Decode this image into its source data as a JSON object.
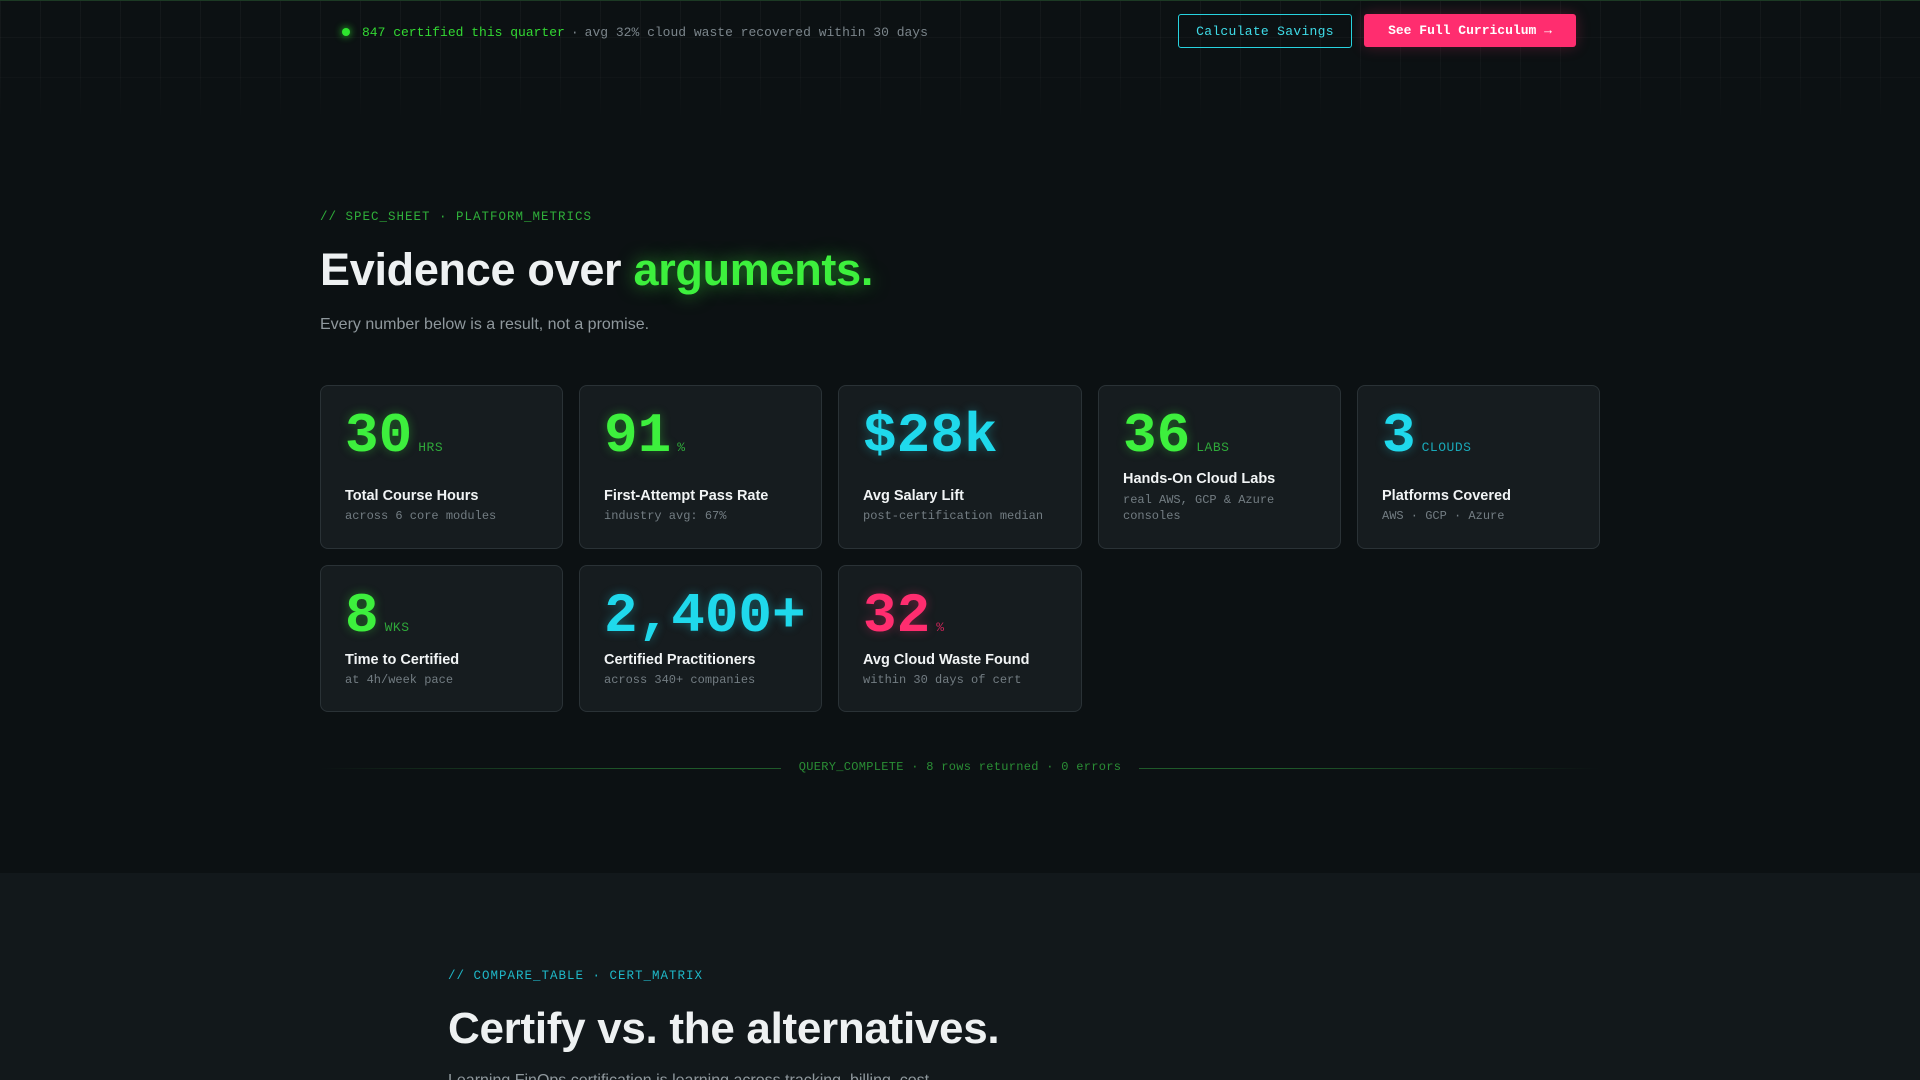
{
  "topbar": {
    "ticker_highlight": "847 certified this quarter",
    "ticker_separator": "·",
    "ticker_rest": "avg 32% cloud waste recovered within 30 days",
    "calculate_button": "Calculate Savings",
    "curriculum_button": "See Full Curriculum →"
  },
  "metrics": {
    "eyebrow": "// SPEC_SHEET · PLATFORM_METRICS",
    "headline_lead": "Evidence over ",
    "headline_accent": "arguments.",
    "subtitle": "Every number below is a result, not a promise.",
    "cards": [
      {
        "value": "30",
        "unit": "HRS",
        "label": "Total Course Hours",
        "desc": "across 6 core modules"
      },
      {
        "value": "91",
        "unit": "%",
        "label": "First-Attempt Pass Rate",
        "desc": "industry avg: 67%"
      },
      {
        "value": "$28k",
        "unit": "",
        "label": "Avg Salary Lift",
        "desc": "post-certification median"
      },
      {
        "value": "36",
        "unit": "LABS",
        "label": "Hands-On Cloud Labs",
        "desc": "real AWS, GCP & Azure consoles"
      },
      {
        "value": "3",
        "unit": "CLOUDS",
        "label": "Platforms Covered",
        "desc": "AWS · GCP · Azure"
      },
      {
        "value": "8",
        "unit": "WKS",
        "label": "Time to Certified",
        "desc": "at 4h/week pace"
      },
      {
        "value": "2,400+",
        "unit": "",
        "label": "Certified Practitioners",
        "desc": "across 340+ companies"
      },
      {
        "value": "32",
        "unit": "%",
        "label": "Avg Cloud Waste Found",
        "desc": "within 30 days of cert"
      }
    ],
    "query_status": "QUERY_COMPLETE · 8 rows returned · 0 errors"
  },
  "compare": {
    "eyebrow": "// COMPARE_TABLE · CERT_MATRIX",
    "headline": "Certify vs. the alternatives.",
    "subtitle": "Learning FinOps certification is learning across tracking, billing, cost..."
  },
  "colors": {
    "green": "#3df03d",
    "cyan": "#1fd9ec",
    "pink": "#ff2d6f",
    "background": "#0c1113",
    "card": "#161c1f"
  }
}
